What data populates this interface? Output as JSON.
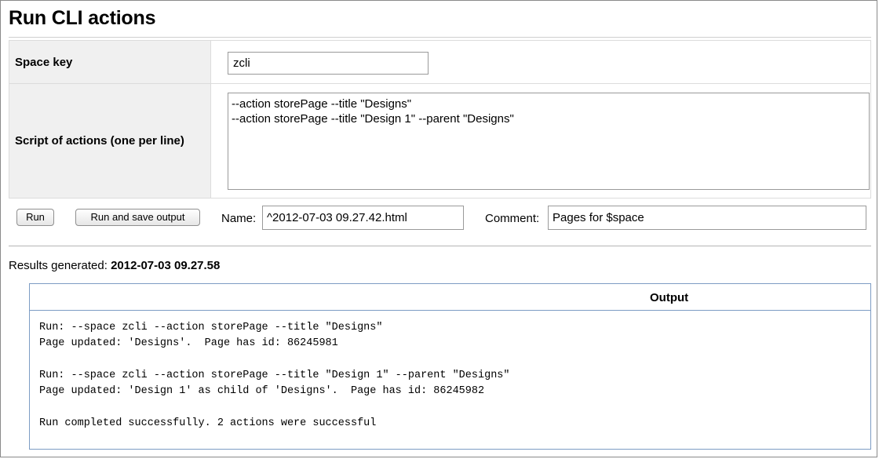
{
  "page": {
    "title": "Run CLI actions"
  },
  "form": {
    "space_key_label": "Space key",
    "space_key_value": "zcli",
    "script_label": "Script of actions (one per line)",
    "script_value": "--action storePage --title \"Designs\"\n--action storePage --title \"Design 1\" --parent \"Designs\""
  },
  "actions": {
    "run_label": "Run",
    "run_save_label": "Run and save output",
    "name_label": "Name:",
    "name_value": "^2012-07-03 09.27.42.html",
    "comment_label": "Comment:",
    "comment_value": "Pages for $space"
  },
  "results": {
    "prefix": "Results generated: ",
    "timestamp": "2012-07-03 09.27.58"
  },
  "output": {
    "header": "Output",
    "lines": [
      "Run: --space zcli --action storePage --title \"Designs\"",
      "Page updated: 'Designs'.  Page has id: 86245981",
      "",
      "Run: --space zcli --action storePage --title \"Design 1\" --parent \"Designs\"",
      "Page updated: 'Design 1' as child of 'Designs'.  Page has id: 86245982",
      "",
      "Run completed successfully. 2 actions were successful"
    ]
  }
}
